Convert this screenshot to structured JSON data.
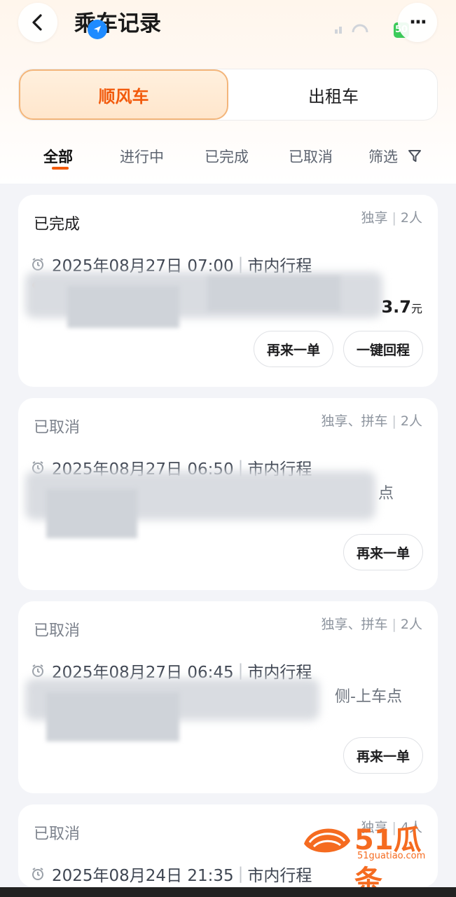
{
  "header": {
    "title": "乘车记录",
    "back_icon": "chevron-left-icon",
    "more_icon": "more-dots-icon",
    "more_label": "···",
    "battery": "50"
  },
  "segment": {
    "active": "顺风车",
    "inactive": "出租车"
  },
  "tabs": [
    {
      "label": "全部"
    },
    {
      "label": "进行中"
    },
    {
      "label": "已完成"
    },
    {
      "label": "已取消"
    },
    {
      "label": "筛选"
    }
  ],
  "cards": [
    {
      "status": "已完成",
      "tag_a": "独享",
      "tag_b": "2人",
      "datetime": "2025年08月27日 07:00",
      "trip_type": "市内行程",
      "price": "3.7",
      "price_unit": "元",
      "btn1": "再来一单",
      "btn2": "一键回程"
    },
    {
      "status": "已取消",
      "tag_a": "独享、拼车",
      "tag_b": "2人",
      "datetime": "2025年08月27日 06:50",
      "trip_type": "市内行程",
      "addr_tail": "点",
      "btn1": "再来一单"
    },
    {
      "status": "已取消",
      "tag_a": "独享、拼车",
      "tag_b": "2人",
      "datetime": "2025年08月27日 06:45",
      "trip_type": "市内行程",
      "addr_tail": "侧-上车点",
      "btn1": "再来一单"
    },
    {
      "status": "已取消",
      "tag_a": "独享",
      "tag_b": "4人",
      "datetime": "2025年08月24日 21:35",
      "trip_type": "市内行程"
    }
  ],
  "watermark": {
    "brand": "51瓜条",
    "site": "51guatiao.com"
  },
  "colors": {
    "accent": "#f25a0c",
    "segment_active_bg": "#ffe6cc",
    "page_bg": "#f3f4f8"
  }
}
